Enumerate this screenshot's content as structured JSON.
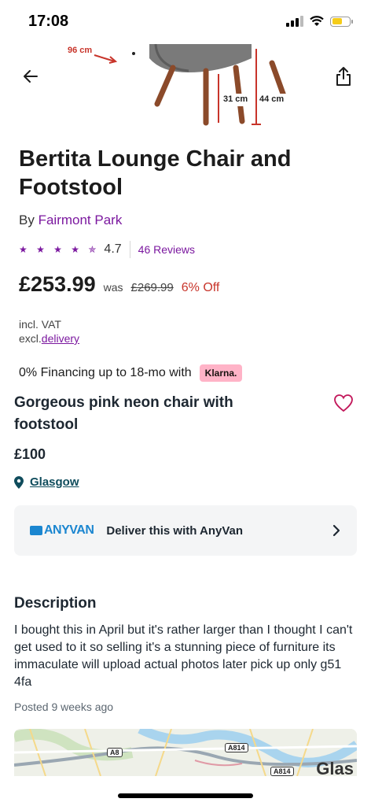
{
  "status_bar": {
    "time": "17:08"
  },
  "hero": {
    "dims": [
      "96 cm",
      "31 cm",
      "44 cm"
    ]
  },
  "product": {
    "title": "Bertita Lounge Chair and Footstool",
    "by_prefix": "By",
    "brand": "Fairmont Park",
    "stars": "★ ★ ★ ★ ✯",
    "rating": "4.7",
    "reviews": "46 Reviews",
    "price": "£253.99",
    "was_label": "was",
    "was_price": "£269.99",
    "discount": "6% Off",
    "vat_line": "incl. VAT",
    "delivery_prefix": "excl.",
    "delivery_link": "delivery",
    "financing": "0% Financing up to 18-mo with",
    "klarna": "Klarna."
  },
  "listing": {
    "title": "Gorgeous pink neon chair with footstool",
    "price": "£100",
    "location": "Glasgow"
  },
  "anyvan": {
    "logo": "ANYVAN",
    "label": "Deliver this with AnyVan"
  },
  "description": {
    "heading": "Description",
    "body": "I bought this in April but it's rather larger than I thought I can't get used to it so selling it's a stunning piece of furniture its immaculate will upload actual photos later pick up only g51 4fa",
    "posted": "Posted 9 weeks ago"
  },
  "map": {
    "labels": [
      "A8",
      "A814",
      "A814"
    ],
    "city": "Glas"
  },
  "colors": {
    "brand_purple": "#7b189f",
    "teal": "#0f4c5c",
    "red": "#c8342a",
    "klarna_pink": "#ffb3c7"
  }
}
